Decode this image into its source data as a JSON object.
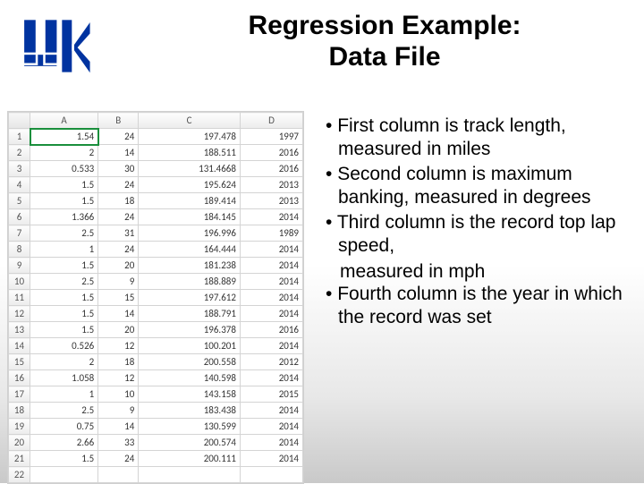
{
  "title_line1": "Regression Example:",
  "title_line2": "Data File",
  "columns": [
    "A",
    "B",
    "C",
    "D"
  ],
  "chart_data": {
    "type": "table",
    "title": "Regression Example: Data File",
    "columns": [
      "A",
      "B",
      "C",
      "D"
    ],
    "column_meanings": [
      "track length (miles)",
      "maximum banking (degrees)",
      "record top lap speed (mph)",
      "year record set"
    ],
    "rows": [
      [
        1.54,
        24,
        197.478,
        1997
      ],
      [
        2,
        14,
        188.511,
        2016
      ],
      [
        0.533,
        30,
        131.4668,
        2016
      ],
      [
        1.5,
        24,
        195.624,
        2013
      ],
      [
        1.5,
        18,
        189.414,
        2013
      ],
      [
        1.366,
        24,
        184.145,
        2014
      ],
      [
        2.5,
        31,
        196.996,
        1989
      ],
      [
        1,
        24,
        164.444,
        2014
      ],
      [
        1.5,
        20,
        181.238,
        2014
      ],
      [
        2.5,
        9,
        188.889,
        2014
      ],
      [
        1.5,
        15,
        197.612,
        2014
      ],
      [
        1.5,
        14,
        188.791,
        2014
      ],
      [
        1.5,
        20,
        196.378,
        2016
      ],
      [
        0.526,
        12,
        100.201,
        2014
      ],
      [
        2,
        18,
        200.558,
        2012
      ],
      [
        1.058,
        12,
        140.598,
        2014
      ],
      [
        1,
        10,
        143.158,
        2015
      ],
      [
        2.5,
        9,
        183.438,
        2014
      ],
      [
        0.75,
        14,
        130.599,
        2014
      ],
      [
        2.66,
        33,
        200.574,
        2014
      ],
      [
        1.5,
        24,
        200.111,
        2014
      ]
    ]
  },
  "bullets": {
    "b1": "First column is track length, measured in miles",
    "b2": "Second column is maximum banking, measured in degrees",
    "b3a": "Third column is the record top lap speed,",
    "b3b": "measured in mph",
    "b4": "Fourth column is the year in which the record was set"
  }
}
